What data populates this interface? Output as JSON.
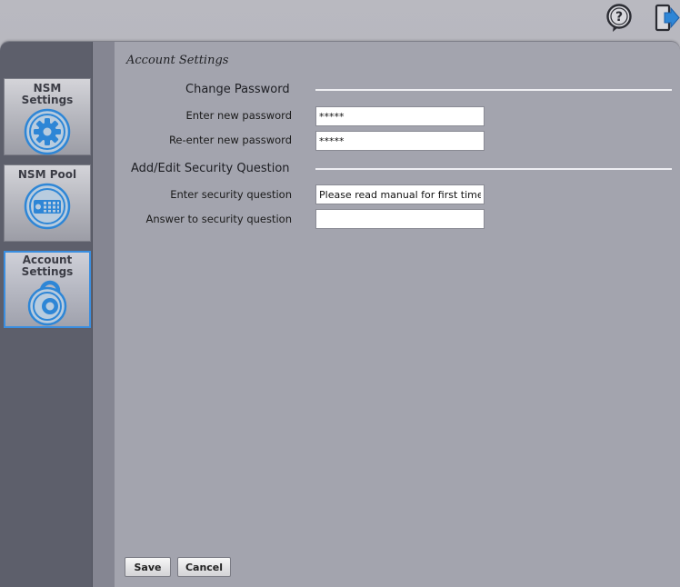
{
  "header": {
    "help_icon": "help-question-icon",
    "logout_icon": "logout-exit-icon"
  },
  "sidebar": {
    "items": [
      {
        "label": "NSM Settings",
        "icon": "gear-settings-icon",
        "active": false
      },
      {
        "label": "NSM Pool",
        "icon": "storage-pool-icon",
        "active": false
      },
      {
        "label": "Account Settings",
        "icon": "padlock-icon",
        "active": true
      }
    ]
  },
  "main": {
    "title": "Account Settings",
    "change_password": {
      "heading": "Change Password",
      "new_password_label": "Enter new password",
      "new_password_value": "*****",
      "reenter_password_label": "Re-enter new password",
      "reenter_password_value": "*****"
    },
    "security_question": {
      "heading": "Add/Edit Security Question",
      "question_label": "Enter security question",
      "question_value": "Please read manual for first time pa",
      "answer_label": "Answer to security question",
      "answer_value": ""
    }
  },
  "footer": {
    "save_label": "Save",
    "cancel_label": "Cancel"
  },
  "colors": {
    "sidebar_bg": "#5d5f6b",
    "content_bg": "#a3a4ae",
    "active_border": "#3a8ee0",
    "icon_blue": "#2e86d6"
  }
}
